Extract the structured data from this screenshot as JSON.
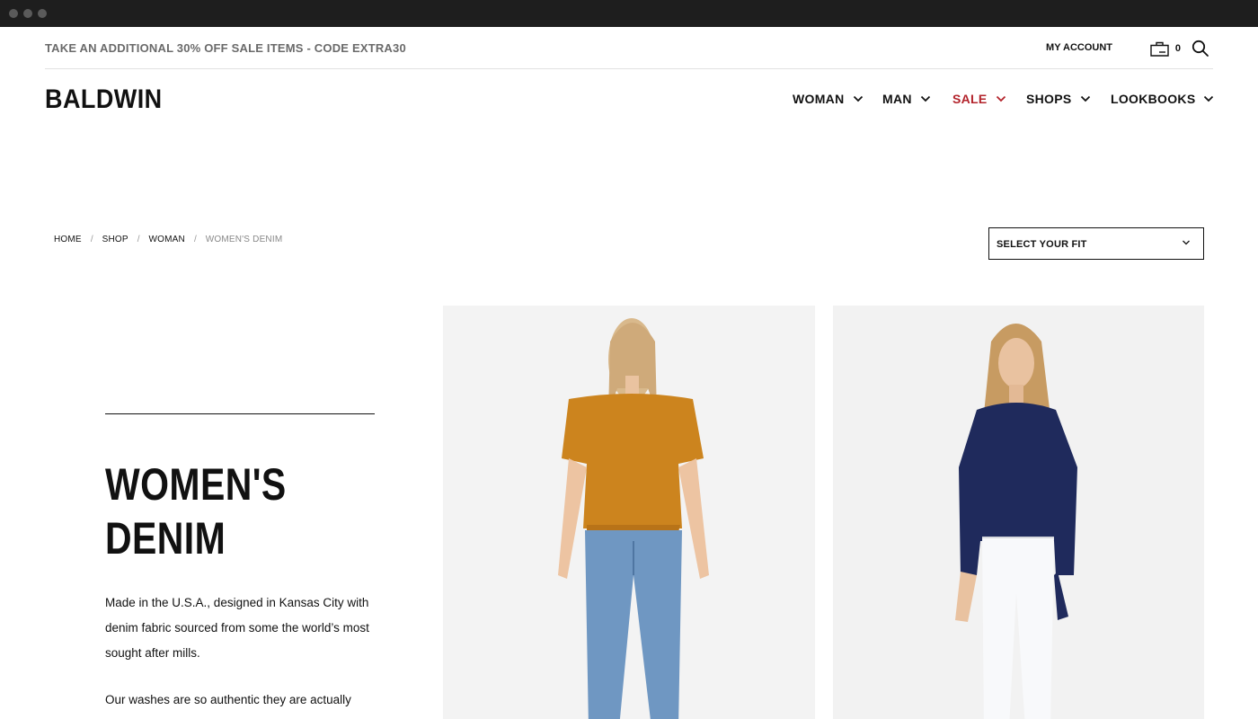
{
  "promo": {
    "text": "TAKE AN ADDITIONAL 30% OFF SALE ITEMS - CODE EXTRA30"
  },
  "header": {
    "account_label": "MY ACCOUNT",
    "cart_count": "0",
    "logo": "BALDWIN"
  },
  "nav": {
    "items": [
      {
        "label": "WOMAN"
      },
      {
        "label": "MAN"
      },
      {
        "label": "SALE"
      },
      {
        "label": "SHOPS"
      },
      {
        "label": "LOOKBOOKS"
      }
    ],
    "sale_color": "#b3232b"
  },
  "breadcrumb": {
    "items": [
      "HOME",
      "SHOP",
      "WOMAN",
      "WOMEN'S DENIM"
    ],
    "separator": "/"
  },
  "fit_select": {
    "selected": "SELECT YOUR FIT"
  },
  "intro": {
    "title_line1": "WOMEN'S",
    "title_line2": "DENIM",
    "paragraph1": "Made in the U.S.A., designed in Kansas City with denim fabric sourced from some the world’s most sought after mills.",
    "paragraph2": "Our washes are so authentic they are actually modeled after our own customer’s break-ins."
  },
  "products": [
    {
      "image": "model-orange-knit-top-blue-jeans"
    },
    {
      "image": "model-navy-blouse-white-jeans"
    }
  ]
}
